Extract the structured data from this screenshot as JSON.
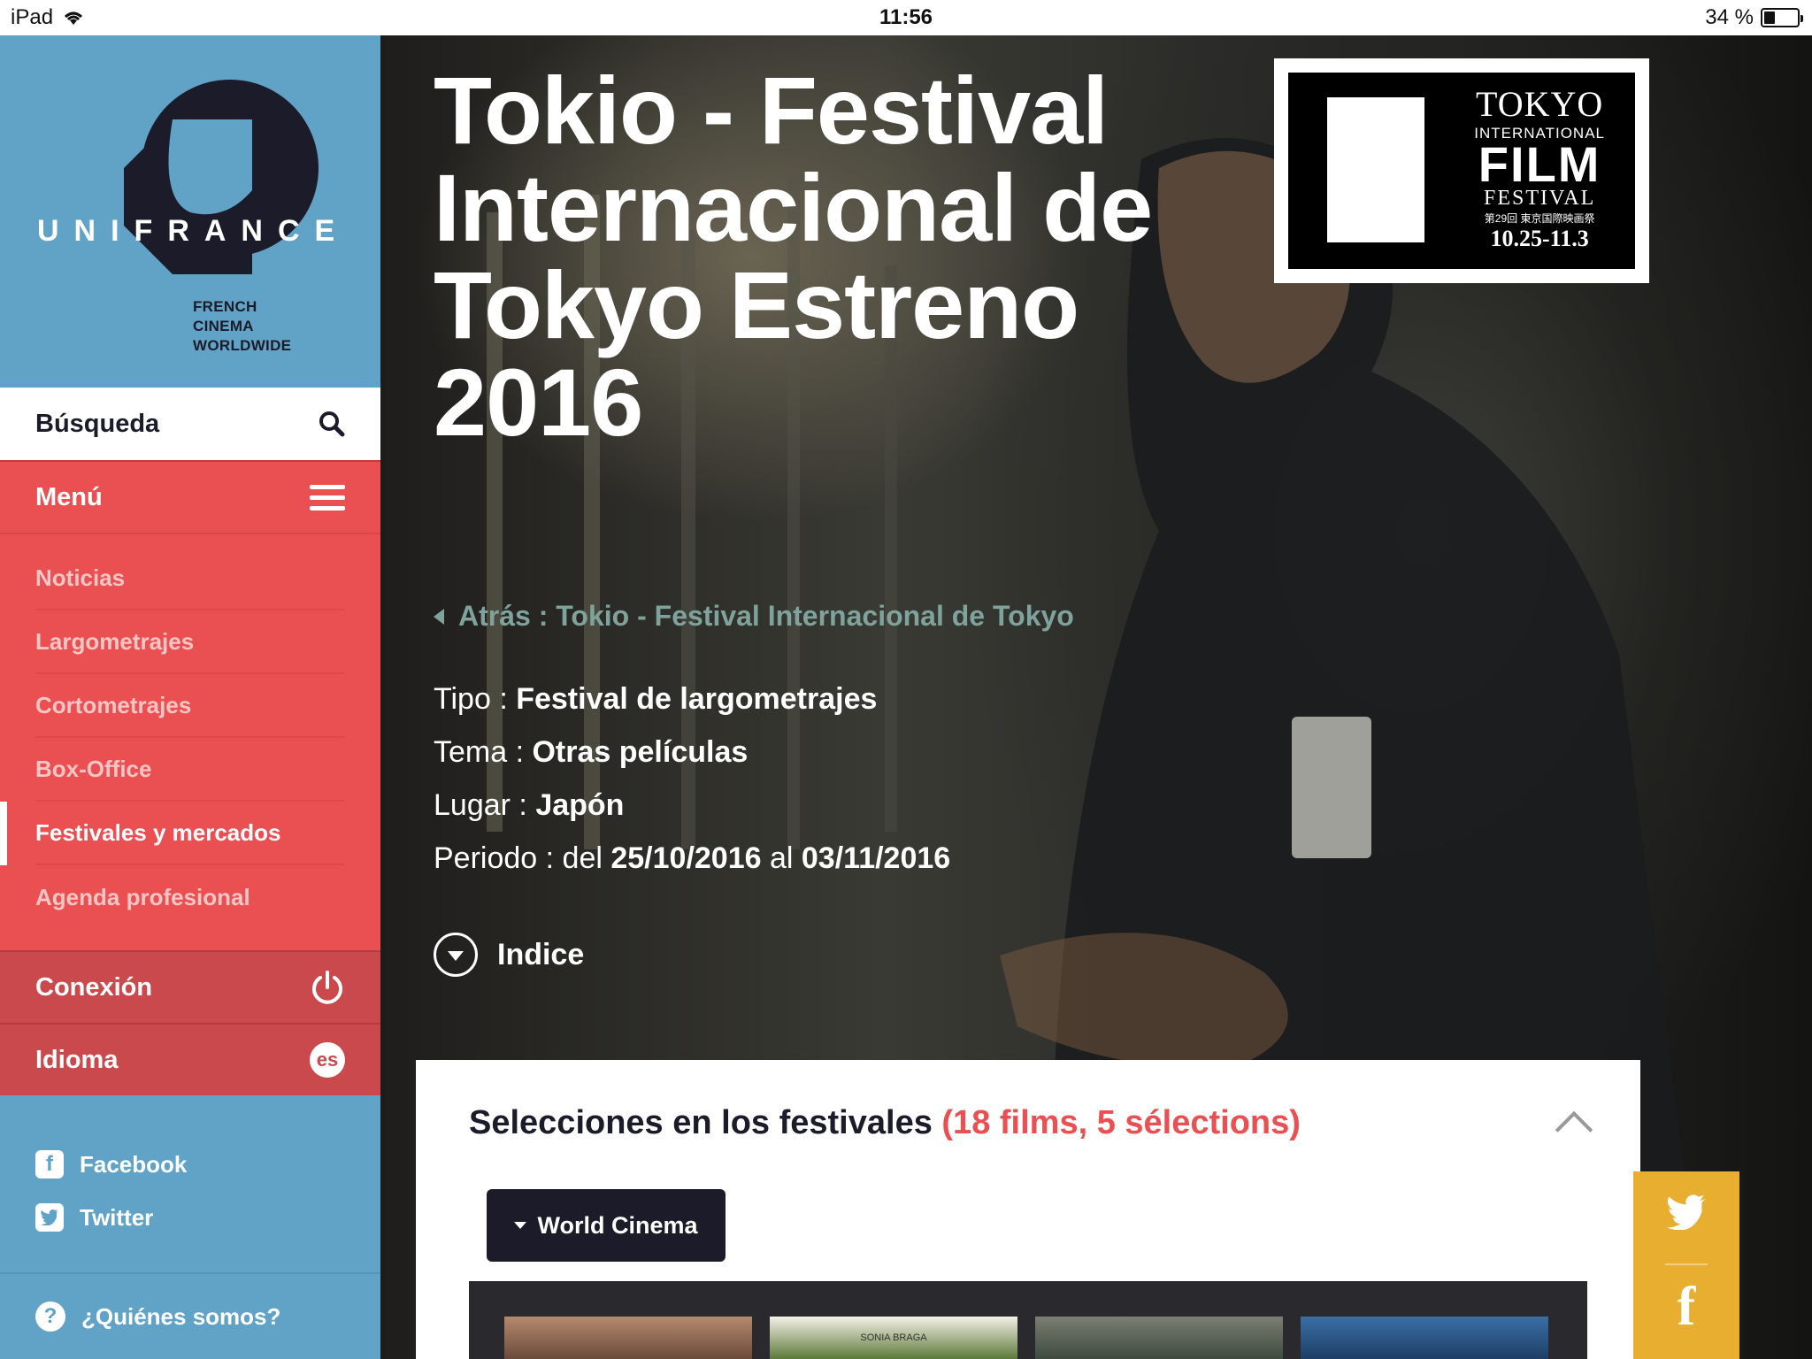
{
  "status_bar": {
    "device": "iPad",
    "time": "11:56",
    "battery": "34 %",
    "battery_level": 0.34
  },
  "sidebar": {
    "logo": {
      "wordmark": "UNIFRANCE",
      "tagline_1": "FRENCH",
      "tagline_2": "CINEMA",
      "tagline_3": "WORLDWIDE"
    },
    "search_label": "Búsqueda",
    "menu_label": "Menú",
    "menu_items": [
      {
        "label": "Noticias"
      },
      {
        "label": "Largometrajes"
      },
      {
        "label": "Cortometrajes"
      },
      {
        "label": "Box-Office"
      },
      {
        "label": "Festivales y mercados"
      },
      {
        "label": "Agenda profesional"
      }
    ],
    "active_item": "Festivales y mercados",
    "connect_label": "Conexión",
    "language_label": "Idioma",
    "language_code": "es",
    "social": [
      {
        "label": "Facebook",
        "icon": "facebook-icon"
      },
      {
        "label": "Twitter",
        "icon": "twitter-icon"
      }
    ],
    "about_label": "¿Quiénes somos?"
  },
  "hero": {
    "title": "Tokio - Festival Internacional de Tokyo Estreno 2016",
    "breadcrumb": "Atrás : Tokio - Festival Internacional de Tokyo",
    "meta": {
      "type_label": "Tipo : ",
      "type_value": "Festival de largometrajes",
      "theme_label": "Tema : ",
      "theme_value": "Otras películas",
      "place_label": "Lugar : ",
      "place_value": "Japón",
      "period_label": "Periodo : del ",
      "period_start": "25/10/2016",
      "period_joiner": " al ",
      "period_end": "03/11/2016"
    },
    "index_label": "Indice",
    "festival_logo": {
      "line1": "TOKYO",
      "line2": "INTERNATIONAL",
      "line3": "FILM",
      "line4": "FESTIVAL",
      "line5": "第29回 東京国際映画祭",
      "line6": "10.25-11.3"
    }
  },
  "panel": {
    "title": "Selecciones en los festivales ",
    "count": "(18 films, 5 sélections)",
    "filter_label": "World Cinema",
    "thumb_caption": "SONIA BRAGA"
  },
  "colors": {
    "sidebar_blue": "#61a3c6",
    "menu_red": "#ea4f52",
    "dark_navy": "#1c1b2a",
    "share_yellow": "#e8ae2f"
  }
}
